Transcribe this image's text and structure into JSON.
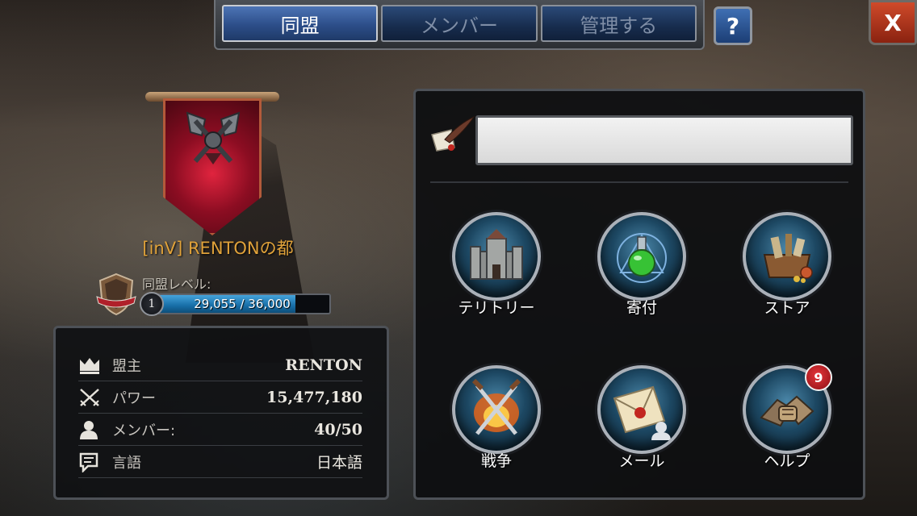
{
  "tabs": [
    {
      "label": "同盟",
      "active": true
    },
    {
      "label": "メンバー",
      "active": false
    },
    {
      "label": "管理する",
      "active": false
    }
  ],
  "help_button": {
    "label": "?"
  },
  "close_button": {
    "label": "X"
  },
  "alliance": {
    "name": "[inV] RENTONの都",
    "level_label": "同盟レベル:",
    "level": "1",
    "xp_text": "29,055 / 36,000",
    "xp_current": 29055,
    "xp_max": 36000
  },
  "info": [
    {
      "icon": "crown-icon",
      "label": "盟主",
      "value": "RENTON"
    },
    {
      "icon": "crossed-swords-icon",
      "label": "パワー",
      "value": "15,477,180"
    },
    {
      "icon": "member-icon",
      "label": "メンバー:",
      "value": "40/50"
    },
    {
      "icon": "speech-bubble-icon",
      "label": "言語",
      "value": "日本語"
    }
  ],
  "announcement": {
    "value": "",
    "placeholder": ""
  },
  "actions": [
    {
      "label": "テリトリー",
      "icon": "castle-icon"
    },
    {
      "label": "寄付",
      "icon": "potion-icon"
    },
    {
      "label": "ストア",
      "icon": "treasure-chest-icon"
    },
    {
      "label": "戦争",
      "icon": "crossed-swords-fire-icon"
    },
    {
      "label": "メール",
      "icon": "envelope-icon"
    },
    {
      "label": "ヘルプ",
      "icon": "gauntlets-icon",
      "badge": "9"
    }
  ],
  "colors": {
    "tab_active": "#2c4e89",
    "tab_inactive": "#172c4d",
    "alliance_name": "#e0a23a",
    "close": "#b8341a",
    "badge": "#d42a30"
  }
}
